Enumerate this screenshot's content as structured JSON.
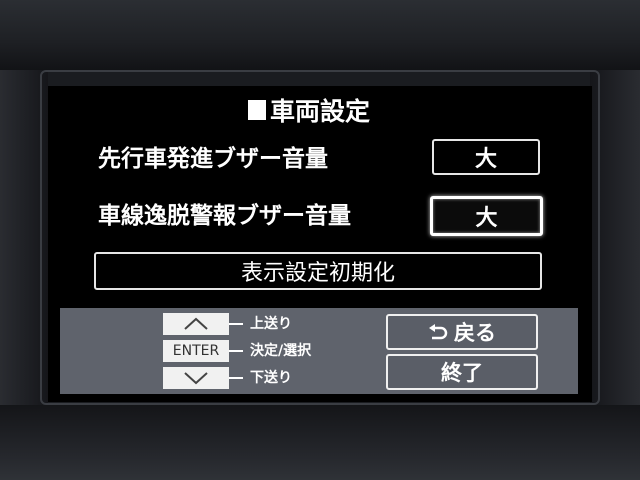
{
  "screen": {
    "title": "車両設定"
  },
  "settings": [
    {
      "label": "先行車発進ブザー音量",
      "value": "大",
      "selected": false
    },
    {
      "label": "車線逸脱警報ブザー音量",
      "value": "大",
      "selected": true
    }
  ],
  "reset_label": "表示設定初期化",
  "controls": {
    "keys": [
      {
        "key": "up-arrow",
        "label": "上送り"
      },
      {
        "key": "ENTER",
        "label": "決定/選択"
      },
      {
        "key": "down-arrow",
        "label": "下送り"
      }
    ],
    "back_label": "戻る",
    "end_label": "終了"
  },
  "icons": {
    "title_marker": "filled-square-icon",
    "up": "chevron-up-icon",
    "down": "chevron-down-icon",
    "back": "return-arrow-icon"
  }
}
